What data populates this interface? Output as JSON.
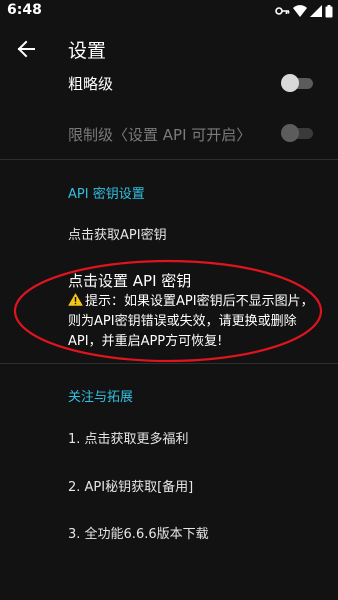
{
  "status_bar": {
    "time": "6:48",
    "icons": [
      "vpn-key-icon",
      "wifi-icon",
      "signal-icon",
      "battery-icon"
    ]
  },
  "app_bar": {
    "title": "设置",
    "back_icon": "arrow-left-icon"
  },
  "prefs_top": [
    {
      "label": "粗略级",
      "switch_on": false,
      "enabled": true
    },
    {
      "label": "限制级〈设置 API 可开启〉",
      "switch_on": false,
      "enabled": false
    }
  ],
  "api_section": {
    "header": "API 密钥设置",
    "get_key": "点击获取API密钥",
    "set_key_title": "点击设置 API 密钥",
    "set_key_summary": "提示：如果设置API密钥后不显示图片，则为API密钥错误或失效，请更换或删除API，并重启APP方可恢复!"
  },
  "follow_section": {
    "header": "关注与拓展",
    "items": [
      "1. 点击获取更多福利",
      "2. API秘钥获取[备用]",
      "3. 全功能6.6.6版本下载"
    ]
  },
  "colors": {
    "background": "#121212",
    "accent": "#33bfe0",
    "annotation": "#e0141e"
  }
}
